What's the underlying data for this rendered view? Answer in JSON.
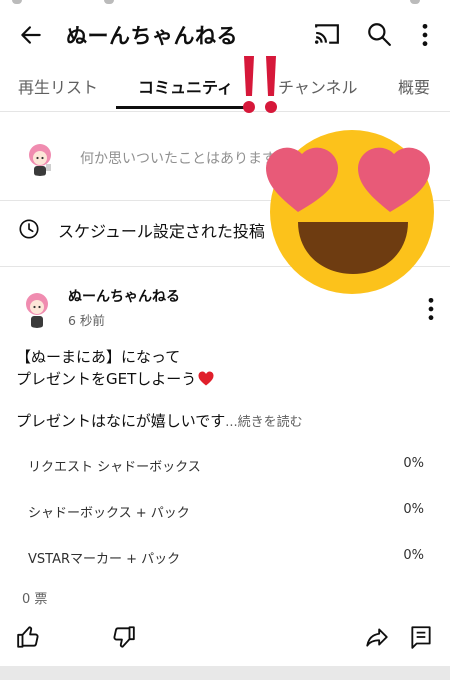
{
  "header": {
    "title": "ぬーんちゃんねる"
  },
  "tabs": [
    {
      "label": "再生リスト"
    },
    {
      "label": "コミュニティ"
    },
    {
      "label": "チャンネル"
    },
    {
      "label": "概要"
    }
  ],
  "compose": {
    "placeholder": "何か思いついたことはありますか？"
  },
  "scheduled": {
    "label": "スケジュール設定された投稿"
  },
  "post": {
    "author": "ぬーんちゃんねる",
    "time": "6 秒前",
    "line1": "【ぬーまにあ】になって",
    "line2": "プレゼントをGETしよーう",
    "line3": "プレゼントはなにが嬉しいです",
    "read_more": "...続きを読む",
    "poll": [
      {
        "label": "リクエスト シャドーボックス",
        "percent": "0%"
      },
      {
        "label": "シャドーボックス + パック",
        "percent": "0%"
      },
      {
        "label": "VSTARマーカー + パック",
        "percent": "0%"
      }
    ],
    "votes": "0 票"
  },
  "icons": {
    "back": "arrow-back-icon",
    "cast": "cast-icon",
    "search": "search-icon",
    "more": "more-vert-icon",
    "clock": "clock-icon",
    "heart": "red-heart-icon",
    "like": "thumbs-up-icon",
    "dislike": "thumbs-down-icon",
    "share": "share-icon",
    "comment": "comment-icon"
  },
  "colors": {
    "heart_red": "#e01f2b",
    "emoji_yellow": "#fcc21b",
    "heart_eye": "#e85a78",
    "exclaim": "#d6183a"
  }
}
